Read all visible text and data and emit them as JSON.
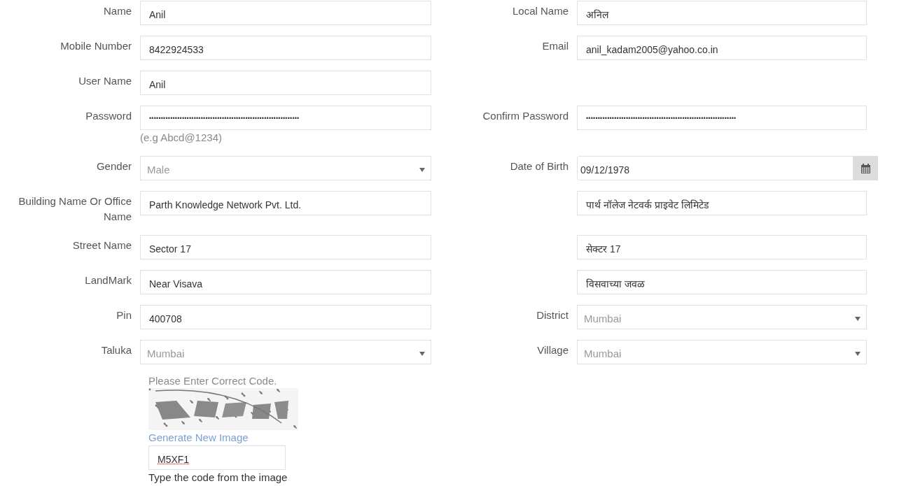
{
  "rows": [
    {
      "left": {
        "label": "Name",
        "kind": "text",
        "value": "Anil"
      },
      "right": {
        "label": "Local Name",
        "kind": "text",
        "value": "अनिल"
      }
    },
    {
      "left": {
        "label": "Mobile Number",
        "kind": "text",
        "value": "8422924533"
      },
      "right": {
        "label": "Email",
        "kind": "text",
        "value": "anil_kadam2005@yahoo.co.in"
      }
    },
    {
      "left": {
        "label": "User Name",
        "kind": "text",
        "value": "Anil"
      }
    },
    {
      "left": {
        "label": "Password",
        "kind": "password",
        "value": "••••••••••••••••••••••••••••••••••••••••••••••••••••••••••••••••",
        "hint": "(e.g Abcd@1234)"
      },
      "right": {
        "label": "Confirm Password",
        "kind": "password",
        "value": "••••••••••••••••••••••••••••••••••••••••••••••••••••••••••••••••"
      }
    },
    {
      "left": {
        "label": "Gender",
        "kind": "select",
        "value": "Male",
        "disabled": true
      },
      "right": {
        "label": "Date of Birth",
        "kind": "date",
        "value": "09/12/1978"
      }
    },
    {
      "left": {
        "label": "Building Name Or Office Name",
        "kind": "text",
        "value": "Parth Knowledge Network Pvt. Ltd."
      },
      "right": {
        "kind": "text",
        "value": "पार्थ नॉलेज नेटवर्क प्राइवेट लिमिटेड"
      }
    },
    {
      "left": {
        "label": "Street Name",
        "kind": "text",
        "value": "Sector 17"
      },
      "right": {
        "kind": "text",
        "value": "सेक्टर 17"
      }
    },
    {
      "left": {
        "label": "LandMark",
        "kind": "text",
        "value": "Near Visava"
      },
      "right": {
        "kind": "text",
        "value": "विसवाच्या जवळ"
      }
    },
    {
      "left": {
        "label": "Pin",
        "kind": "text",
        "value": "400708"
      },
      "right": {
        "label": "District",
        "kind": "select",
        "value": "Mumbai",
        "disabled": true
      }
    },
    {
      "left": {
        "label": "Taluka",
        "kind": "select",
        "value": "Mumbai",
        "disabled": true
      },
      "right": {
        "label": "Village",
        "kind": "select",
        "value": "Mumbai",
        "disabled": true
      }
    }
  ],
  "captcha": {
    "prompt": "Please Enter Correct Code.",
    "link": "Generate New Image",
    "value": "M5XF1",
    "help": "Type the code from the image"
  }
}
